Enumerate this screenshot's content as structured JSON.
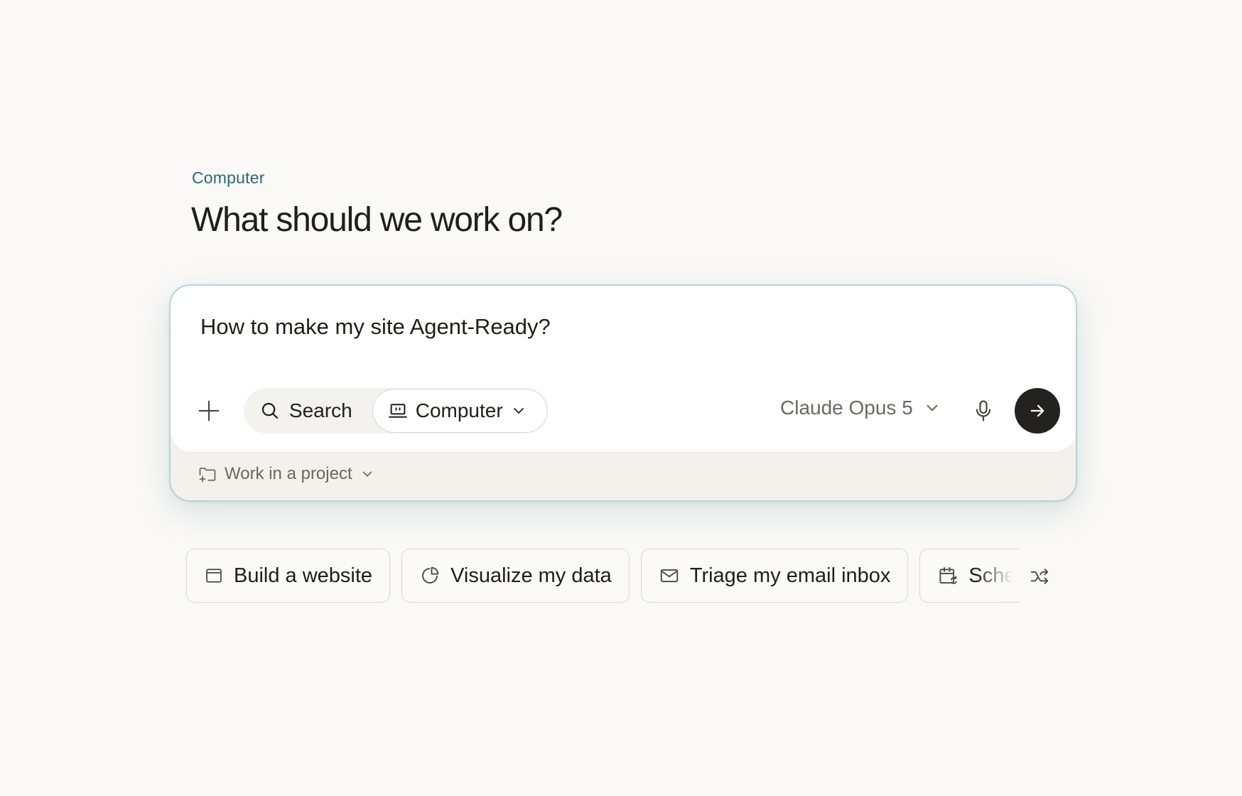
{
  "header": {
    "eyebrow": "Computer",
    "title": "What should we work on?"
  },
  "composer": {
    "prompt_text": "How to make my site Agent-Ready?",
    "tools": {
      "search_label": "Search",
      "computer_label": "Computer"
    },
    "model_label": "Claude Opus 5",
    "project_label": "Work in a project"
  },
  "suggestions": [
    {
      "label": "Build a website",
      "icon": "browser-window-icon"
    },
    {
      "label": "Visualize my data",
      "icon": "pie-chart-icon"
    },
    {
      "label": "Triage my email inbox",
      "icon": "mail-icon"
    },
    {
      "label": "Sche",
      "icon": "calendar-sync-icon"
    }
  ],
  "colors": {
    "accent": "#2b6a73",
    "send_button": "#23221e",
    "background": "#faf9f7"
  }
}
